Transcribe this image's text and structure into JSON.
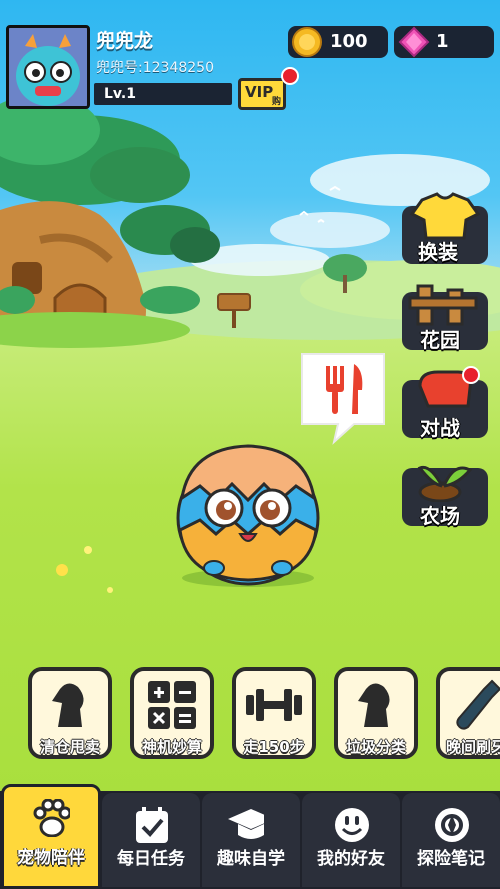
{
  "player": {
    "name": "兜兜龙",
    "id_label": "兜兜号:12348250",
    "level": "Lv.1",
    "vip_label": "VIP",
    "vip_buy": "购"
  },
  "currency": {
    "coins": "100",
    "gems": "1"
  },
  "side_buttons": [
    "换装",
    "花园",
    "对战",
    "农场"
  ],
  "activities": [
    "清仓甩卖",
    "神机妙算",
    "走150步",
    "垃圾分类",
    "晚间刷牙"
  ],
  "tabs": [
    "宠物陪伴",
    "每日任务",
    "趣味自学",
    "我的好友",
    "探险笔记"
  ],
  "active_tab": "宠物陪伴",
  "colors": {
    "sky": "#2fb7f1",
    "grass": "#a6de3a",
    "accent_yellow": "#ffd83b",
    "panel_dark": "#1f222b",
    "notification_red": "#e8212c"
  }
}
